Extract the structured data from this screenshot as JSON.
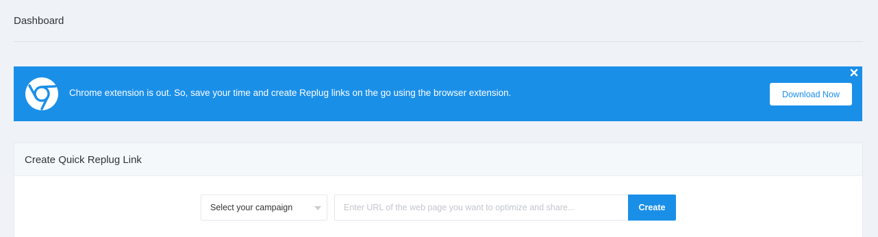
{
  "header": {
    "title": "Dashboard"
  },
  "banner": {
    "message": "Chrome extension is out. So, save your time and create Replug links on the go using the browser extension.",
    "button_label": "Download Now",
    "icon": "chrome-icon",
    "close_icon": "close-icon",
    "color": "#1a8fe8"
  },
  "quick_link": {
    "title": "Create Quick Replug Link",
    "campaign_select": {
      "selected": "Select your campaign"
    },
    "url_input": {
      "placeholder": "Enter URL of the web page you want to optimize and share...",
      "value": ""
    },
    "create_label": "Create"
  }
}
